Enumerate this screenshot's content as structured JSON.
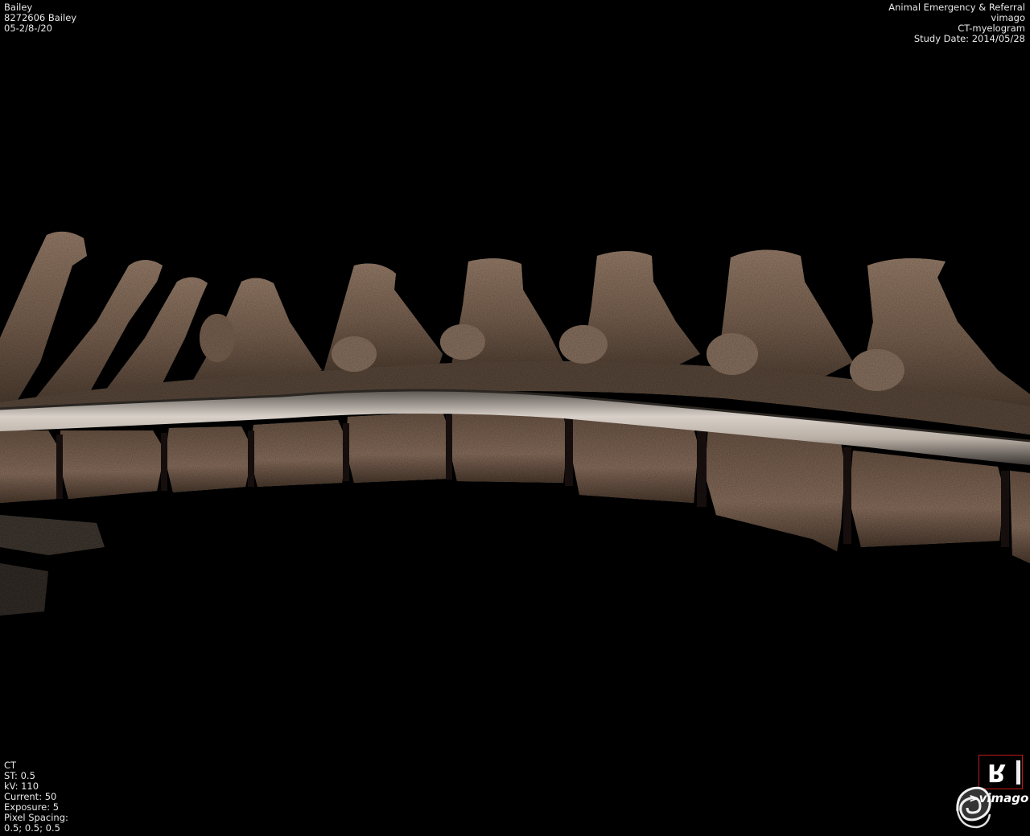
{
  "patient": {
    "name": "Bailey",
    "id_line": "8272606 Bailey",
    "dob": "05-2/8-/20"
  },
  "study": {
    "institution": "Animal Emergency & Referral",
    "software": "vimago",
    "description": "CT-myelogram",
    "study_date": "Study Date: 2014/05/28"
  },
  "acquisition": {
    "modality": "CT",
    "slice_thickness": "ST: 0.5",
    "kv": "kV: 110",
    "current": "Current: 50",
    "exposure": "Exposure: 5",
    "pixel_spacing_label": "Pixel Spacing:",
    "pixel_spacing_value": "0.5; 0.5; 0.5"
  },
  "logo": {
    "text": ">vimago"
  },
  "colors": {
    "background": "#000000",
    "bone": "#7a6555",
    "bone_light": "#a89080",
    "bone_dark": "#3a2e26",
    "contrast_column": "#c8c0b8",
    "orientation_border": "#c01818"
  },
  "icons": {
    "orientation_marker": "orientation-cube-icon",
    "logo": "nautilus-shell-icon"
  }
}
